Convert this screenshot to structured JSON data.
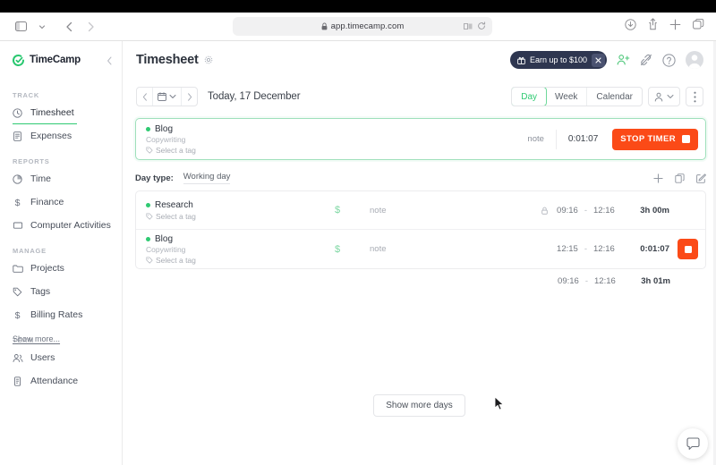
{
  "browser": {
    "url": "app.timecamp.com",
    "lock_icon": "lock-icon",
    "sidebar_toggle_icon": "sidebar-toggle-icon",
    "tab_chevron_icon": "chevron-down-icon",
    "back_icon": "back-arrow-icon",
    "forward_icon": "forward-arrow-icon",
    "reader_icon": "reader-view-icon",
    "reload_icon": "reload-icon",
    "download_icon": "download-icon",
    "share_icon": "share-icon",
    "new_tab_icon": "plus-icon",
    "tabs_icon": "tabs-overview-icon"
  },
  "sidebar": {
    "brand": "TimeCamp",
    "brand_icon": "timecamp-logo-icon",
    "collapse_icon": "chevron-left-icon",
    "show_more": "Show more...",
    "sections": [
      {
        "label": "TRACK",
        "items": [
          {
            "label": "Timesheet",
            "icon": "clock-icon",
            "active": true
          },
          {
            "label": "Expenses",
            "icon": "receipt-icon",
            "active": false
          }
        ]
      },
      {
        "label": "REPORTS",
        "items": [
          {
            "label": "Time",
            "icon": "pie-chart-icon",
            "active": false
          },
          {
            "label": "Finance",
            "icon": "dollar-icon",
            "active": false
          },
          {
            "label": "Computer Activities",
            "icon": "laptop-icon",
            "active": false
          }
        ]
      },
      {
        "label": "MANAGE",
        "items": [
          {
            "label": "Projects",
            "icon": "folder-icon",
            "active": false
          },
          {
            "label": "Tags",
            "icon": "tag-icon",
            "active": false
          },
          {
            "label": "Billing Rates",
            "icon": "dollar-icon",
            "active": false
          }
        ]
      },
      {
        "label": "TEAM",
        "items": [
          {
            "label": "Users",
            "icon": "users-icon",
            "active": false
          },
          {
            "label": "Attendance",
            "icon": "attendance-icon",
            "active": false
          }
        ]
      }
    ]
  },
  "header": {
    "title": "Timesheet",
    "settings_icon": "gear-icon",
    "promo_label": "Earn up to $100",
    "promo_icon": "gift-icon",
    "promo_close_icon": "close-icon",
    "invite_icon": "add-user-icon",
    "integrations_icon": "plug-icon",
    "help_icon": "help-icon",
    "avatar_icon": "avatar-icon"
  },
  "toolbar": {
    "prev_icon": "chevron-left-icon",
    "calendar_icon": "calendar-icon",
    "calendar_chevron_icon": "chevron-down-icon",
    "next_icon": "chevron-right-icon",
    "date_label": "Today, 17 December",
    "views": [
      {
        "label": "Day",
        "selected": true
      },
      {
        "label": "Week",
        "selected": false
      },
      {
        "label": "Calendar",
        "selected": false
      }
    ],
    "user_filter_icon": "user-icon",
    "user_filter_chevron_icon": "chevron-down-icon",
    "more_icon": "kebab-menu-icon"
  },
  "timer_card": {
    "task": "Blog",
    "project": "Copywriting",
    "tag_placeholder": "Select a tag",
    "tag_icon": "tag-icon",
    "note": "note",
    "duration": "0:01:07",
    "stop_label": "STOP TIMER",
    "stop_icon": "stop-square-icon",
    "dot_color": "#2fca72",
    "accent_color": "#fb4a17"
  },
  "day_type": {
    "label": "Day type:",
    "value": "Working day",
    "add_icon": "plus-icon",
    "copy_icon": "duplicate-icon",
    "edit_icon": "edit-icon"
  },
  "entries": {
    "rows": [
      {
        "task": "Research",
        "project": "",
        "tag_placeholder": "Select a tag",
        "billable": "$",
        "note": "note",
        "locked": true,
        "lock_icon": "lock-icon",
        "time_from": "09:16",
        "time_dash": "-",
        "time_to": "12:16",
        "total": "3h 00m",
        "running": false
      },
      {
        "task": "Blog",
        "project": "Copywriting",
        "tag_placeholder": "Select a tag",
        "billable": "$",
        "note": "note",
        "locked": false,
        "lock_icon": "",
        "time_from": "12:15",
        "time_dash": "-",
        "time_to": "12:16",
        "total": "0:01:07",
        "running": true,
        "stop_icon": "stop-square-icon"
      }
    ],
    "totals": {
      "time_from": "09:16",
      "time_dash": "-",
      "time_to": "12:16",
      "total": "3h 01m"
    }
  },
  "footer": {
    "show_more_days": "Show more days"
  },
  "chat": {
    "icon": "chat-bubble-icon"
  }
}
